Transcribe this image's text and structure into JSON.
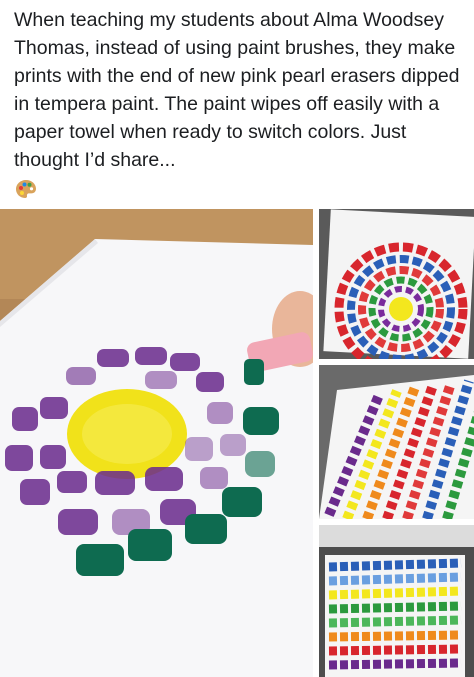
{
  "post": {
    "text": "When teaching my students about Alma Woodsey Thomas, instead of using paint brushes, they make prints with the end of new pink pearl erasers dipped in tempera paint. The paint wipes off easily with a paper towel when ready to switch colors. Just thought I’d share...",
    "emoji_icon": "artist-palette-icon"
  },
  "colors": {
    "purple": "#6a2a8c",
    "green": "#0e6b50",
    "yellow": "#f1e21a",
    "eraser_pink": "#f2a7b5",
    "desk": "#b98d5a"
  }
}
